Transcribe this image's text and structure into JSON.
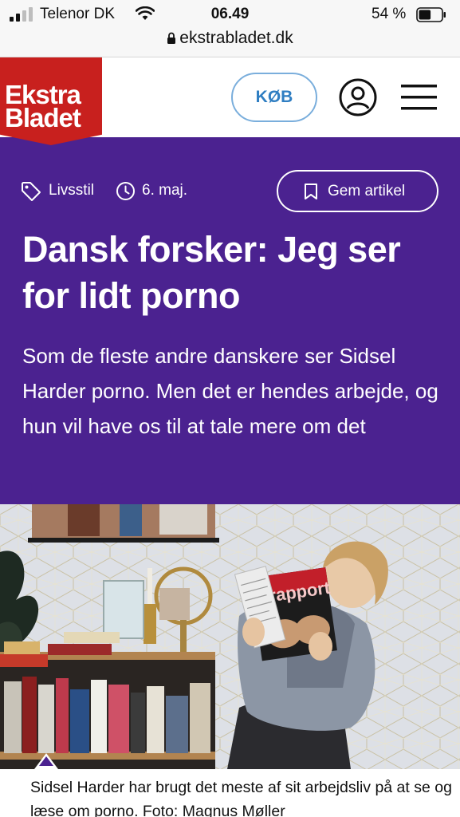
{
  "status_bar": {
    "carrier": "Telenor DK",
    "time": "06.49",
    "battery_percent": "54 %",
    "battery_level": 0.54
  },
  "url_bar": {
    "domain": "ekstrabladet.dk"
  },
  "site_header": {
    "logo_line1": "Ekstra",
    "logo_line2": "Bladet",
    "buy_label": "KØB",
    "brand_color": "#c8201e"
  },
  "article": {
    "category": "Livsstil",
    "date": "6. maj.",
    "save_label": "Gem artikel",
    "headline": "Dansk forsker: Jeg ser for lidt porno",
    "subheadline": "Som de fleste andre danskere ser Sidsel Harder porno. Men det er hendes arbejde, og hun vil have os til at tale mere om det",
    "accent_color": "#4b2290",
    "caption": "Sidsel Harder har brugt det meste af sit arbejdsliv på at se og læse om porno. Foto: Magnus Møller"
  },
  "photo": {
    "magazine_title": "rapport"
  }
}
